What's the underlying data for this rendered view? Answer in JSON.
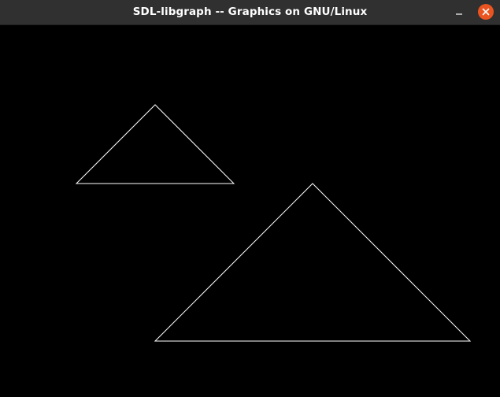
{
  "window": {
    "title": "SDL-libgraph -- Graphics on GNU/Linux",
    "controls": {
      "minimize_icon": "minimize-icon",
      "close_icon": "close-icon"
    },
    "colors": {
      "titlebar": "#303030",
      "close_button": "#e95420",
      "canvas_background": "#000000",
      "stroke": "#ffffff"
    }
  },
  "canvas": {
    "shapes": [
      {
        "type": "triangle",
        "outline": true,
        "color": "#ffffff"
      },
      {
        "type": "triangle",
        "outline": true,
        "color": "#ffffff"
      }
    ]
  }
}
